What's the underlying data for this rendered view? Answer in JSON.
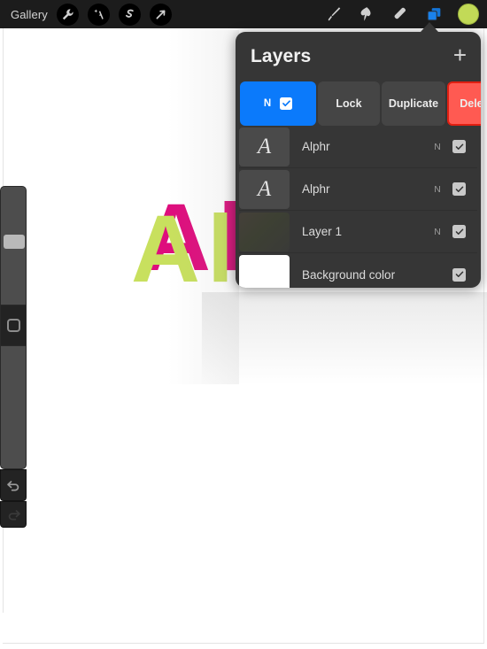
{
  "toolbar": {
    "gallery_label": "Gallery",
    "left_tools": [
      {
        "name": "wrench-icon",
        "label": "Actions"
      },
      {
        "name": "magic-wand-icon",
        "label": "Adjustments"
      },
      {
        "name": "selection-s-icon",
        "label": "Selection"
      },
      {
        "name": "transform-arrow-icon",
        "label": "Transform"
      }
    ],
    "right_tools": [
      {
        "name": "brush-icon",
        "label": "Paint"
      },
      {
        "name": "smudge-icon",
        "label": "Smudge"
      },
      {
        "name": "eraser-icon",
        "label": "Erase"
      },
      {
        "name": "layers-icon",
        "label": "Layers",
        "active": true
      }
    ],
    "color_swatch": "#c2da57"
  },
  "sidebar": {
    "brush_size_label": "Brush size",
    "brush_opacity_label": "Brush opacity",
    "modify_label": "Modify",
    "undo_label": "Undo",
    "redo_label": "Redo"
  },
  "artwork": {
    "text": "Al",
    "front_color": "#c8e05e",
    "shadow_color": "#de0d7d"
  },
  "layers_panel": {
    "title": "Layers",
    "add_label": "+",
    "actions": [
      {
        "name": "blend-mode",
        "label": "N",
        "checked": true,
        "color": "#0b7afb"
      },
      {
        "name": "lock",
        "label": "Lock"
      },
      {
        "name": "duplicate",
        "label": "Duplicate"
      },
      {
        "name": "delete",
        "label": "Delete",
        "color": "#ff5a52"
      }
    ],
    "layers": [
      {
        "name": "Alphr",
        "blend": "N",
        "visible": true,
        "thumb": "letter-a"
      },
      {
        "name": "Alphr",
        "blend": "N",
        "visible": true,
        "thumb": "letter-a"
      },
      {
        "name": "Layer 1",
        "blend": "N",
        "visible": true,
        "thumb": "artwork"
      },
      {
        "name": "Background color",
        "blend": "",
        "visible": true,
        "thumb": "white"
      }
    ]
  }
}
